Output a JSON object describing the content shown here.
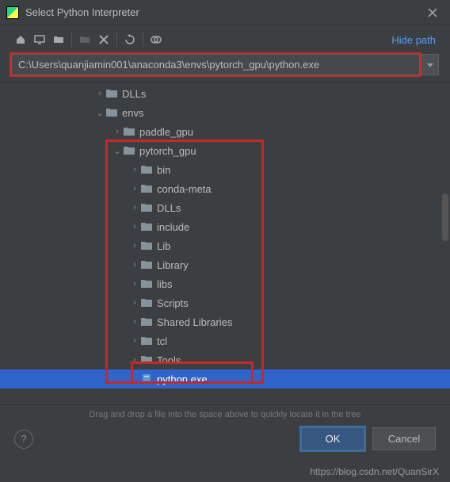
{
  "titlebar": {
    "title": "Select Python Interpreter"
  },
  "toolbar": {
    "hide_path": "Hide path"
  },
  "path": {
    "value": "C:\\Users\\quanjiamin001\\anaconda3\\envs\\pytorch_gpu\\python.exe"
  },
  "tree": {
    "nodes": [
      {
        "indent": 118,
        "expander": "›",
        "icon": "folder",
        "label": "DLLs"
      },
      {
        "indent": 118,
        "expander": "⌄",
        "icon": "folder",
        "label": "envs"
      },
      {
        "indent": 140,
        "expander": "›",
        "icon": "folder",
        "label": "paddle_gpu"
      },
      {
        "indent": 140,
        "expander": "⌄",
        "icon": "folder",
        "label": "pytorch_gpu"
      },
      {
        "indent": 162,
        "expander": "›",
        "icon": "folder",
        "label": "bin"
      },
      {
        "indent": 162,
        "expander": "›",
        "icon": "folder",
        "label": "conda-meta"
      },
      {
        "indent": 162,
        "expander": "›",
        "icon": "folder",
        "label": "DLLs"
      },
      {
        "indent": 162,
        "expander": "›",
        "icon": "folder",
        "label": "include"
      },
      {
        "indent": 162,
        "expander": "›",
        "icon": "folder",
        "label": "Lib"
      },
      {
        "indent": 162,
        "expander": "›",
        "icon": "folder",
        "label": "Library"
      },
      {
        "indent": 162,
        "expander": "›",
        "icon": "folder",
        "label": "libs"
      },
      {
        "indent": 162,
        "expander": "›",
        "icon": "folder",
        "label": "Scripts"
      },
      {
        "indent": 162,
        "expander": "›",
        "icon": "folder",
        "label": "Shared Libraries"
      },
      {
        "indent": 162,
        "expander": "›",
        "icon": "folder",
        "label": "tcl"
      },
      {
        "indent": 162,
        "expander": "›",
        "icon": "folder",
        "label": "Tools"
      },
      {
        "indent": 162,
        "expander": "",
        "icon": "file",
        "label": "python.exe",
        "selected": true
      }
    ]
  },
  "hint": "Drag and drop a file into the space above to quickly locate it in the tree",
  "footer": {
    "ok": "OK",
    "cancel": "Cancel"
  },
  "watermark": "https://blog.csdn.net/QuanSirX"
}
